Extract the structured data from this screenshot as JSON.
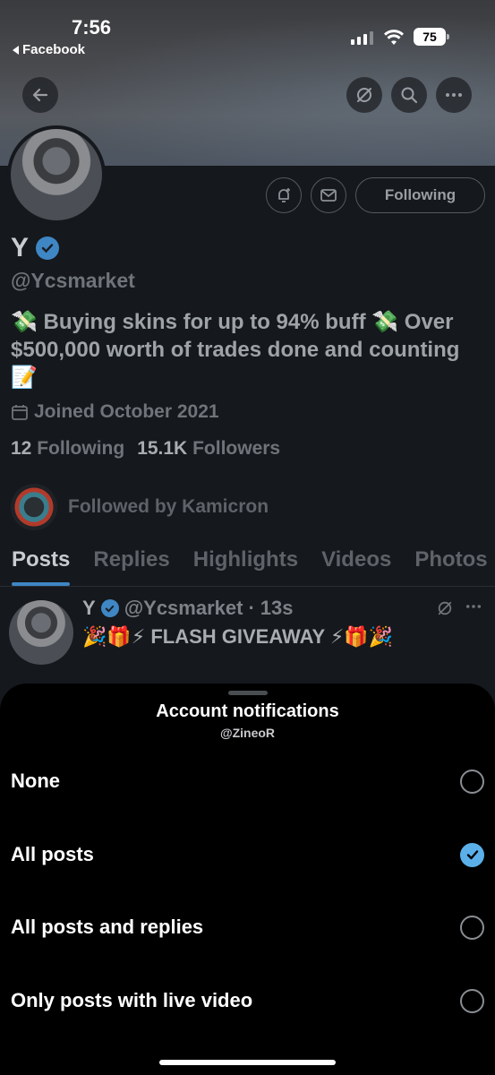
{
  "status_bar": {
    "time": "7:56",
    "back_app": "Facebook",
    "battery": "75"
  },
  "profile": {
    "name": "Y",
    "handle": "@Ycsmarket",
    "bio": "💸 Buying skins for up to 94% buff 💸 Over $500,000 worth of trades done and counting 📝",
    "joined": "Joined October 2021",
    "following_count": "12",
    "following_label": "Following",
    "followers_count": "15.1K",
    "followers_label": "Followers",
    "followed_by": "Followed by Kamicron",
    "follow_button": "Following",
    "verified_color": "#3f86c4"
  },
  "tabs": [
    {
      "label": "Posts",
      "active": true
    },
    {
      "label": "Replies"
    },
    {
      "label": "Highlights"
    },
    {
      "label": "Videos"
    },
    {
      "label": "Photos"
    }
  ],
  "post": {
    "name": "Y",
    "handle": "@Ycsmarket",
    "separator": "·",
    "time": "13s",
    "text": "🎉🎁⚡ FLASH GIVEAWAY ⚡🎁🎉"
  },
  "sheet": {
    "title": "Account notifications",
    "subtitle": "@ZineoR",
    "options": [
      {
        "label": "None",
        "selected": false
      },
      {
        "label": "All posts",
        "selected": true
      },
      {
        "label": "All posts and replies",
        "selected": false
      },
      {
        "label": "Only posts with live video",
        "selected": false
      }
    ],
    "accent": "#5bb0ea"
  },
  "icons": {
    "back": "arrow-left-icon",
    "grok": "grok-icon",
    "search": "search-icon",
    "more": "more-icon",
    "notify": "bell-plus-icon",
    "message": "envelope-icon",
    "calendar": "calendar-icon",
    "check": "checkmark-icon"
  }
}
